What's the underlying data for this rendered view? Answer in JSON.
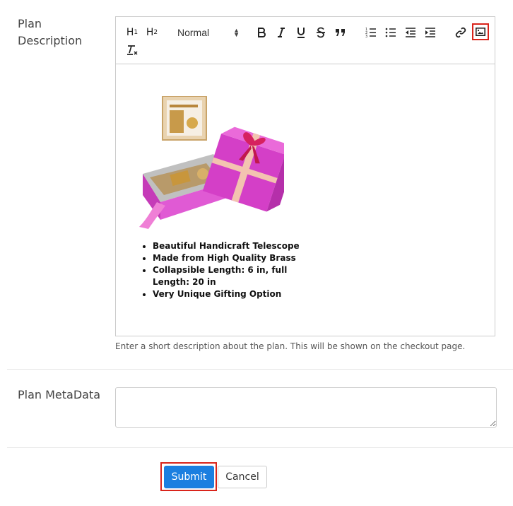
{
  "plan_description": {
    "label": "Plan Description",
    "toolbar": {
      "h1": "H",
      "h1_sub": "1",
      "h2": "H",
      "h2_sub": "2",
      "format_select": "Normal",
      "icons": [
        "bold-icon",
        "italic-icon",
        "underline-icon",
        "strike-icon",
        "quote-icon",
        "ordered-list-icon",
        "bullet-list-icon",
        "outdent-icon",
        "indent-icon",
        "link-icon",
        "image-icon",
        "clear-format-icon"
      ]
    },
    "content": {
      "image": "gift-box-product-image",
      "bullets": [
        "Beautiful Handicraft Telescope",
        "Made from High Quality Brass",
        "Collapsible Length: 6 in, full Length: 20 in",
        "Very Unique Gifting Option"
      ]
    },
    "help_text": "Enter a short description about the plan. This will be shown on the checkout page."
  },
  "plan_metadata": {
    "label": "Plan MetaData",
    "value": ""
  },
  "actions": {
    "submit_label": "Submit",
    "cancel_label": "Cancel"
  },
  "colors": {
    "submit_bg": "#1b7fe0",
    "highlight": "#d9241b",
    "gift_pink": "#d43fc7"
  }
}
